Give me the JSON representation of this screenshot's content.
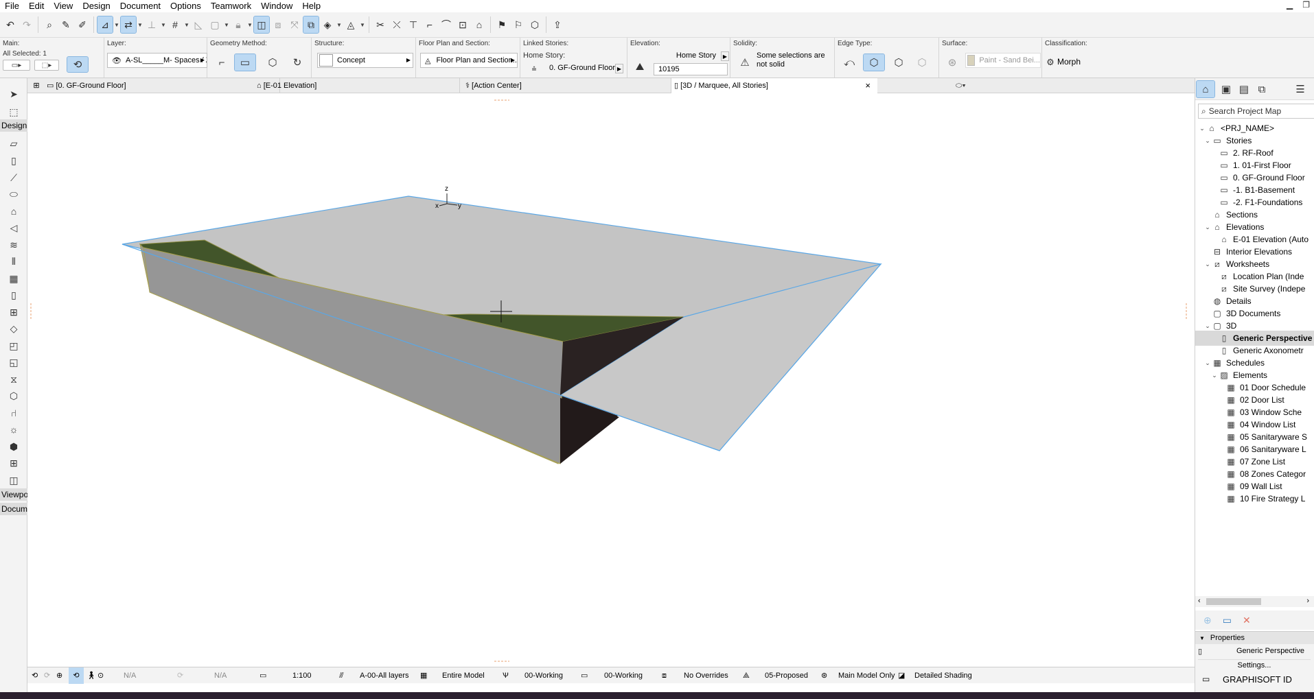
{
  "menu": [
    "File",
    "Edit",
    "View",
    "Design",
    "Document",
    "Options",
    "Teamwork",
    "Window",
    "Help"
  ],
  "infobox": {
    "main": {
      "label": "Main:",
      "selected": "All Selected: 1"
    },
    "layer": {
      "label": "Layer:",
      "value": "A-SL_____M- Spaces / Zo..."
    },
    "geometry": {
      "label": "Geometry Method:"
    },
    "structure": {
      "label": "Structure:",
      "value": "Concept"
    },
    "floorplan": {
      "label": "Floor Plan and Section:",
      "value": "Floor Plan and Section..."
    },
    "linked": {
      "label": "Linked Stories:",
      "home_label": "Home Story:",
      "home_value": "0. GF-Ground Floor"
    },
    "elevation": {
      "label": "Elevation:",
      "ref": "Home Story",
      "value": "10195"
    },
    "solidity": {
      "label": "Solidity:",
      "text": "Some selections are not solid"
    },
    "edge": {
      "label": "Edge Type:"
    },
    "surface": {
      "label": "Surface:",
      "value": "Paint - Sand Bei..."
    },
    "classification": {
      "label": "Classification:",
      "value": "Morph"
    }
  },
  "tabs": [
    {
      "label": "[0. GF-Ground Floor]"
    },
    {
      "label": "[E-01 Elevation]"
    },
    {
      "label": "[Action Center]"
    },
    {
      "label": "[3D / Marquee, All Stories]",
      "close": "×"
    }
  ],
  "toolbox": {
    "design": "Design",
    "viewpoint": "Viewpoi",
    "document": "Docume"
  },
  "viewport": {
    "axis_x": "x",
    "axis_y": "y",
    "axis_z": "z"
  },
  "status": {
    "na1": "N/A",
    "na2": "N/A",
    "scale": "1:100",
    "layers": "A-00-All layers",
    "model": "Entire Model",
    "pen": "00-Working",
    "mvo": "00-Working",
    "override": "No Overrides",
    "renovation": "05-Proposed",
    "structure": "Main Model Only",
    "shading": "Detailed Shading"
  },
  "navigator": {
    "search_placeholder": "Search Project Map",
    "tree": [
      {
        "label": "<PRJ_NAME>",
        "level": 0,
        "tw": "v",
        "icon": "project-icon"
      },
      {
        "label": "Stories",
        "level": 1,
        "tw": "v",
        "icon": "stories-icon"
      },
      {
        "label": "2. RF-Roof",
        "level": 2,
        "tw": "",
        "icon": "story-icon"
      },
      {
        "label": "1. 01-First Floor",
        "level": 2,
        "tw": "",
        "icon": "story-icon"
      },
      {
        "label": "0. GF-Ground Floor",
        "level": 2,
        "tw": "",
        "icon": "story-icon"
      },
      {
        "label": "-1. B1-Basement",
        "level": 2,
        "tw": "",
        "icon": "story-icon"
      },
      {
        "label": "-2. F1-Foundations",
        "level": 2,
        "tw": "",
        "icon": "story-icon"
      },
      {
        "label": "Sections",
        "level": 1,
        "tw": "",
        "icon": "section-icon"
      },
      {
        "label": "Elevations",
        "level": 1,
        "tw": "v",
        "icon": "elevation-icon"
      },
      {
        "label": "E-01 Elevation (Auto",
        "level": 2,
        "tw": "",
        "icon": "elevation-icon"
      },
      {
        "label": "Interior Elevations",
        "level": 1,
        "tw": "",
        "icon": "interior-elevation-icon"
      },
      {
        "label": "Worksheets",
        "level": 1,
        "tw": "v",
        "icon": "worksheet-icon"
      },
      {
        "label": "Location Plan (Inde",
        "level": 2,
        "tw": "",
        "icon": "worksheet-icon"
      },
      {
        "label": "Site Survey (Indepe",
        "level": 2,
        "tw": "",
        "icon": "worksheet-icon"
      },
      {
        "label": "Details",
        "level": 1,
        "tw": "",
        "icon": "details-icon"
      },
      {
        "label": "3D Documents",
        "level": 1,
        "tw": "",
        "icon": "3d-document-icon"
      },
      {
        "label": "3D",
        "level": 1,
        "tw": "v",
        "icon": "3d-icon"
      },
      {
        "label": "Generic Perspective",
        "level": 2,
        "tw": "",
        "icon": "perspective-icon",
        "selected": true
      },
      {
        "label": "Generic Axonometr",
        "level": 2,
        "tw": "",
        "icon": "axonometry-icon"
      },
      {
        "label": "Schedules",
        "level": 1,
        "tw": "v",
        "icon": "schedule-icon"
      },
      {
        "label": "Elements",
        "level": 2,
        "tw": "v",
        "icon": "elements-icon"
      },
      {
        "label": "01 Door Schedule",
        "level": 3,
        "tw": "",
        "icon": "table-icon"
      },
      {
        "label": "02 Door List",
        "level": 3,
        "tw": "",
        "icon": "table-icon"
      },
      {
        "label": "03 Window Sche",
        "level": 3,
        "tw": "",
        "icon": "table-icon"
      },
      {
        "label": "04 Window List",
        "level": 3,
        "tw": "",
        "icon": "table-icon"
      },
      {
        "label": "05 Sanitaryware S",
        "level": 3,
        "tw": "",
        "icon": "table-icon"
      },
      {
        "label": "06 Sanitaryware L",
        "level": 3,
        "tw": "",
        "icon": "table-icon"
      },
      {
        "label": "07 Zone List",
        "level": 3,
        "tw": "",
        "icon": "table-icon"
      },
      {
        "label": "08 Zones Categor",
        "level": 3,
        "tw": "",
        "icon": "table-icon"
      },
      {
        "label": "09 Wall List",
        "level": 3,
        "tw": "",
        "icon": "table-icon"
      },
      {
        "label": "10 Fire Strategy L",
        "level": 3,
        "tw": "",
        "icon": "table-icon"
      }
    ],
    "properties_label": "Properties",
    "properties_view": "Generic Perspective",
    "settings": "Settings...",
    "graphisoft_id": "GRAPHISOFT ID"
  }
}
